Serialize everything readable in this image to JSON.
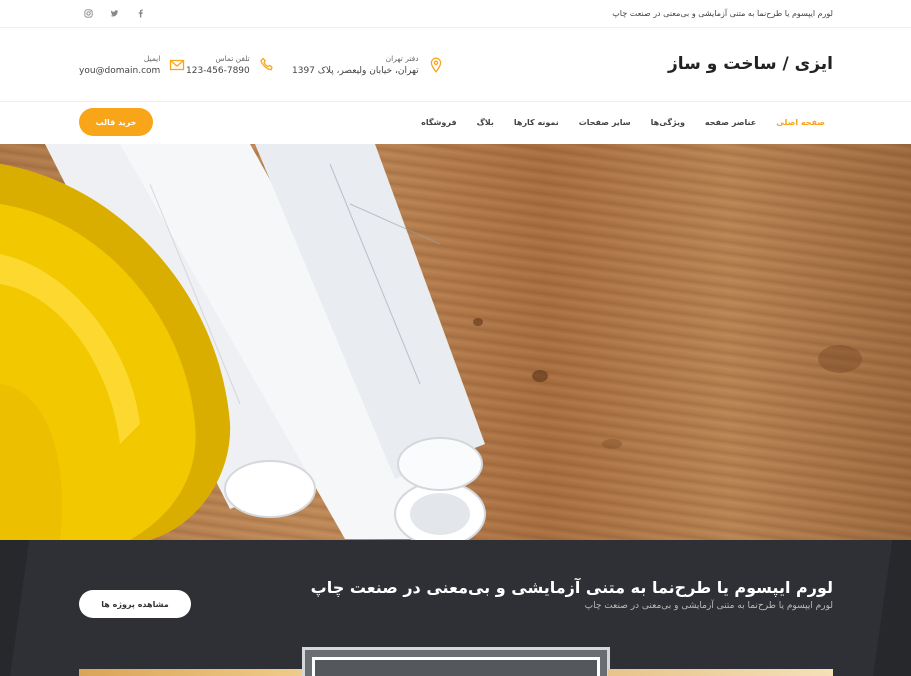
{
  "topbar": {
    "tagline": "لورم ایپسوم یا طرح‌نما به متنی آزمایشی و بی‌معنی در صنعت چاپ",
    "socials": [
      "facebook-icon",
      "twitter-icon",
      "instagram-icon"
    ]
  },
  "header": {
    "logo": "ایزی / ساخت و ساز",
    "address": {
      "label": "دفتر تهران",
      "value": "تهران، خیابان ولیعصر، پلاک 1397"
    },
    "phone": {
      "label": "تلفن تماس",
      "value": "123-456-7890"
    },
    "email": {
      "label": "ایمیل",
      "value": "you@domain.com"
    }
  },
  "nav": {
    "items": [
      {
        "label": "صفحه اصلی",
        "active": true
      },
      {
        "label": "عناصر صفحه"
      },
      {
        "label": "ویژگی‌ها"
      },
      {
        "label": "سایر صفحات"
      },
      {
        "label": "نمونه کارها"
      },
      {
        "label": "بلاگ"
      },
      {
        "label": "فروشگاه"
      }
    ],
    "buy_label": "خرید قالب"
  },
  "band": {
    "title": "لورم ایپسوم یا طرح‌نما به متنی آزمایشی و بی‌معنی در صنعت چاپ",
    "subtitle": "لورم ایپسوم یا طرح‌نما به متنی آزمایشی و بی‌معنی در صنعت چاپ",
    "button_label": "مشاهده پروژه ها"
  },
  "colors": {
    "accent": "#f9a51a",
    "dark": "#2e3035"
  }
}
